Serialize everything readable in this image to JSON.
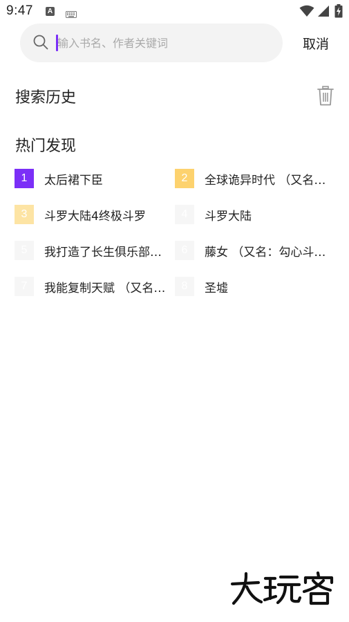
{
  "status_bar": {
    "time": "9:47",
    "icons": [
      "a-notification-icon",
      "keyboard-icon",
      "wifi-icon",
      "signal-icon",
      "battery-charging-icon"
    ]
  },
  "search": {
    "placeholder": "输入书名、作者关键词",
    "value": "",
    "cancel_label": "取消"
  },
  "history": {
    "title": "搜索历史",
    "clear_icon": "trash-icon"
  },
  "hot": {
    "title": "热门发现",
    "items": [
      {
        "rank": "1",
        "title": "太后裙下臣",
        "rank_color": "#7b2ff7"
      },
      {
        "rank": "2",
        "title": "全球诡异时代 （又名：全球诡异时代之我本无敌）",
        "rank_color": "#fdd26e"
      },
      {
        "rank": "3",
        "title": "斗罗大陆4终极斗罗",
        "rank_color": "#fde4a4"
      },
      {
        "rank": "4",
        "title": "斗罗大陆",
        "rank_color": "#f6f6f6"
      },
      {
        "rank": "5",
        "title": "我打造了长生俱乐部（全本）",
        "rank_color": "#f6f6f6"
      },
      {
        "rank": "6",
        "title": "藤女 （又名：勾心斗角）",
        "rank_color": "#f6f6f6"
      },
      {
        "rank": "7",
        "title": "我能复制天赋 （又名：我能复制天赋之万界）",
        "rank_color": "#f6f6f6"
      },
      {
        "rank": "8",
        "title": "圣墟",
        "rank_color": "#f6f6f6"
      }
    ]
  },
  "watermark": {
    "text": "大玩客"
  }
}
